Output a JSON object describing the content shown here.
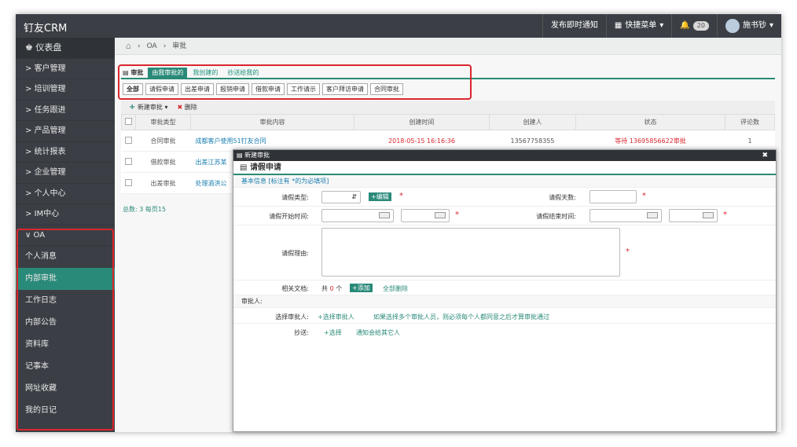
{
  "app": {
    "title": "钉友CRM"
  },
  "topbar": {
    "publish": "发布即时通知",
    "quick_menu": "快捷菜单",
    "bell_count": "20",
    "user": "施书钞"
  },
  "sidebar": {
    "dashboard": "仪表盘",
    "items": [
      "客户管理",
      "培训管理",
      "任务跟进",
      "产品管理",
      "统计报表",
      "企业管理",
      "个人中心",
      "IM中心"
    ],
    "oa_label": "OA",
    "oa_items": [
      "个人消息",
      "内部审批",
      "工作日志",
      "内部公告",
      "资料库",
      "记事本",
      "网址收藏",
      "我的日记"
    ]
  },
  "breadcrumb": {
    "oa": "OA",
    "current": "审批"
  },
  "tabs1": {
    "title": "审批",
    "items": [
      "由我审批的",
      "我创建的",
      "抄送给我的"
    ]
  },
  "tabs2": [
    "全部",
    "请假申请",
    "出差申请",
    "报销申请",
    "借款申请",
    "工作请示",
    "客户拜访申请",
    "合同审批"
  ],
  "toolbar": {
    "new": "新建审批",
    "delete": "删除"
  },
  "table": {
    "headers": [
      "审批类型",
      "审批内容",
      "创建时间",
      "创建人",
      "状态",
      "评论数"
    ],
    "rows": [
      [
        "合同审批",
        "成都客户使用51钉友合同",
        "2018-05-15 16:16:36",
        "13567758355",
        "等待 13695856622审批",
        "1"
      ],
      [
        "借款审批",
        "出差江苏某",
        "",
        "",
        "",
        ""
      ],
      [
        "出差审批",
        "处理酒洪公",
        "",
        "",
        "",
        ""
      ]
    ],
    "footer": "总数: 3 每页15"
  },
  "modal": {
    "bar_title": "新建审批",
    "title": "请假申请",
    "basic_info": "基本信息 [标注有 *的为必填项]",
    "leave_type": "请假类型:",
    "edit": "编辑",
    "leave_days": "请假天数:",
    "start_time": "请假开始时间:",
    "end_time": "请假结束时间:",
    "reason": "请假理由:",
    "docs": "相关文档:",
    "docs_count_pre": "共",
    "docs_count": "0",
    "docs_count_post": "个",
    "add": "添加",
    "delete_all": "全部删除",
    "approver_section": "审批人:",
    "select_approver_label": "选择审批人:",
    "select_approver_link": "选择审批人",
    "approver_note": "如果选择多个审批人员，则必须每个人都同意之后才算审批通过",
    "cc_label": "抄送:",
    "cc_select": "选择",
    "cc_notify": "通知会给其它人"
  }
}
